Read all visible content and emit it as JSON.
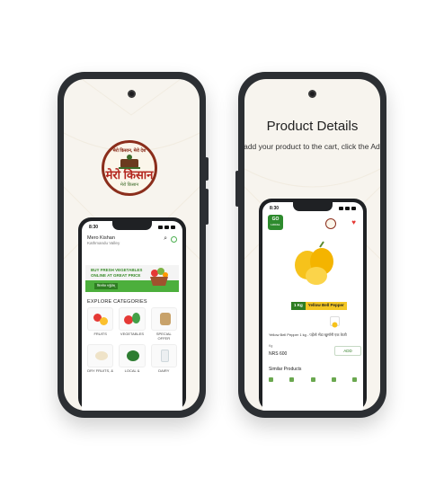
{
  "left_phone": {
    "logo": {
      "top_text": "मेरो किसान, मेरो देश",
      "brand": "मेरो किसान",
      "sub": "मेरो किसान"
    },
    "mini_app": {
      "status_time": "8:30",
      "header_title": "Mero Kishan",
      "header_location": "Kathmandu Valley",
      "banner_line1": "BUY FRESH VEGETABLES",
      "banner_line2": "ONLINE AT GREAT PRICE",
      "banner_button": "किनमेल गर्नुहोस्",
      "section_title": "EXPLORE CATEGORIES",
      "categories": [
        "FRUITS",
        "VEGETABLES",
        "SPECIAL OFFER",
        "DRY FRUITS, &",
        "LOCAL &",
        "DAIRY"
      ]
    }
  },
  "right_phone": {
    "heading": "Product Details",
    "subheading": "o add your product to the cart, click the Add butto",
    "mini_app": {
      "status_time": "8:30",
      "go_logo_line1": "GO",
      "go_logo_line2": "LOCAL",
      "weight_chip": "1 Kg",
      "weight_name": "Yellow Bell Pepper",
      "product_name": "Yellow Bell Pepper 1 kg - पहेंलो भेंडा खुर्सानी एक केजी",
      "unit_label": "Kg",
      "price": "NRS 600",
      "add_label": "ADD",
      "similar_label": "Similar Products"
    }
  },
  "colors": {
    "brand_green": "#2e7d22",
    "banner_green": "#4caf3c",
    "logo_red": "#b3261e",
    "phone_body": "#2c2f33",
    "accent_yellow": "#f3c623"
  }
}
